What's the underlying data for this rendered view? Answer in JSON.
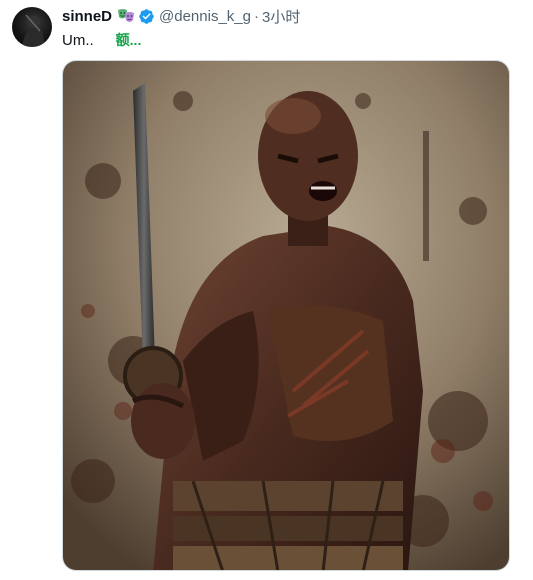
{
  "tweet": {
    "display_name": "sinneD",
    "handle": "@dennis_k_g",
    "separator": "·",
    "timestamp": "3小时",
    "text": "Um..",
    "translation_hint": "额...",
    "emoji_icon": "theater-masks-icon",
    "badge_icon": "verified-badge-icon",
    "colors": {
      "verified": "#1d9bf0",
      "translation": "#17a34a",
      "muted": "#536471"
    }
  }
}
